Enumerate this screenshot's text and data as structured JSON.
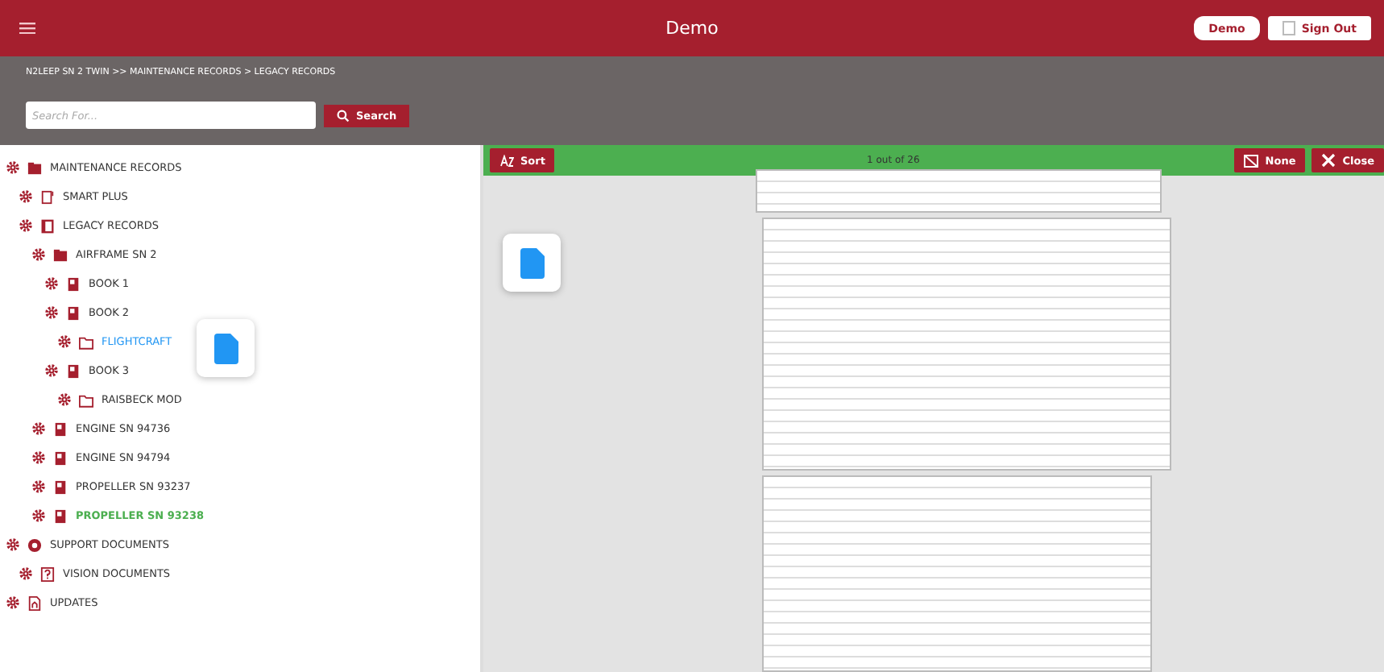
{
  "header": {
    "title": "Demo",
    "buttons": [
      "Demo",
      "Sign Out"
    ]
  },
  "breadcrumb": "N2LEEP SN 2 TWIN >> MAINTENANCE RECORDS > LEGACY RECORDS",
  "search": {
    "placeholder": "Search For...",
    "button": "Search"
  },
  "tree": [
    {
      "label": "MAINTENANCE RECORDS",
      "kind": "folders",
      "selected": false,
      "hovered": false,
      "children": [
        {
          "label": "SMART PLUS",
          "kind": "tablet",
          "selected": false,
          "hovered": false
        },
        {
          "label": "LEGACY RECORDS",
          "kind": "binder",
          "selected": false,
          "hovered": false,
          "children": [
            {
              "label": "AIRFRAME SN 2",
              "kind": "folders",
              "selected": false,
              "hovered": false,
              "children": [
                {
                  "label": "BOOK 1",
                  "kind": "book",
                  "selected": false,
                  "hovered": false
                },
                {
                  "label": "BOOK 2",
                  "kind": "book",
                  "selected": false,
                  "hovered": false,
                  "children": [
                    {
                      "label": "FLIGHTCRAFT",
                      "kind": "folder",
                      "selected": false,
                      "hovered": true
                    }
                  ]
                },
                {
                  "label": "BOOK 3",
                  "kind": "book",
                  "selected": false,
                  "hovered": false,
                  "children": [
                    {
                      "label": "RAISBECK MOD",
                      "kind": "folder",
                      "selected": false,
                      "hovered": false
                    }
                  ]
                }
              ]
            },
            {
              "label": "ENGINE SN 94736",
              "kind": "book",
              "selected": false,
              "hovered": false
            },
            {
              "label": "ENGINE SN 94794",
              "kind": "book",
              "selected": false,
              "hovered": false
            },
            {
              "label": "PROPELLER SN 93237",
              "kind": "book",
              "selected": false,
              "hovered": false
            },
            {
              "label": "PROPELLER SN 93238",
              "kind": "book",
              "selected": true,
              "hovered": false
            }
          ]
        }
      ]
    },
    {
      "label": "SUPPORT DOCUMENTS",
      "kind": "support",
      "selected": false,
      "hovered": false,
      "children": [
        {
          "label": "VISION DOCUMENTS",
          "kind": "question",
          "selected": false,
          "hovered": false
        }
      ]
    },
    {
      "label": "UPDATES",
      "kind": "update",
      "selected": false,
      "hovered": false
    }
  ],
  "viewer": {
    "sort": "Sort",
    "counter": "1 out of 26",
    "buttons": [
      "None",
      "Close"
    ]
  }
}
